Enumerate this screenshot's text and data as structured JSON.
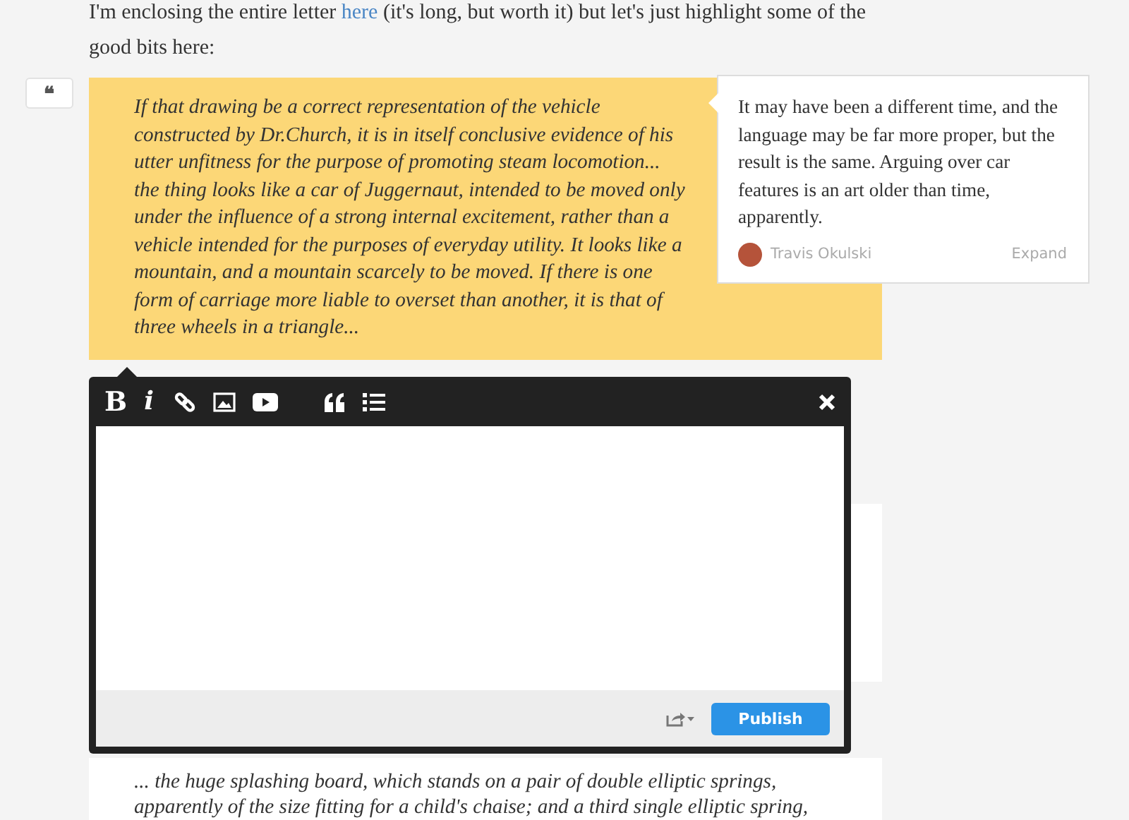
{
  "intro": {
    "before": "I'm enclosing the entire letter ",
    "link": "here",
    "after": " (it's long, but worth it) but let's just highlight some of the good bits here:"
  },
  "quote_button": {
    "label": "❝"
  },
  "blockquote": {
    "text": "If that drawing be a correct representation of the vehicle constructed by Dr.Church, it is in itself conclusive evidence of his utter unfitness for the purpose of promoting steam locomotion... the thing looks like a car of Juggernaut, intended to be moved only under the influence of a strong internal excitement, rather than a vehicle intended for the purposes of everyday utility. It looks like a mountain, and a mountain scarcely to be moved. If there is one form of carriage more liable to overset than another, it is that of three wheels in a triangle..."
  },
  "comment": {
    "text": "It may have been a different time, and the language may be far more proper, but the result is the same. Arguing over car features is an art older than time, apparently.",
    "author": "Travis Okulski",
    "action": "Expand"
  },
  "editor": {
    "bold": "B",
    "italic": "i",
    "publish": "Publish"
  },
  "second_quote": {
    "lines": [
      "... the huge splashing board, which stands on a pair of double elliptic springs,",
      "apparently of the size fitting for a child's chaise; and a third single elliptic spring,"
    ]
  }
}
